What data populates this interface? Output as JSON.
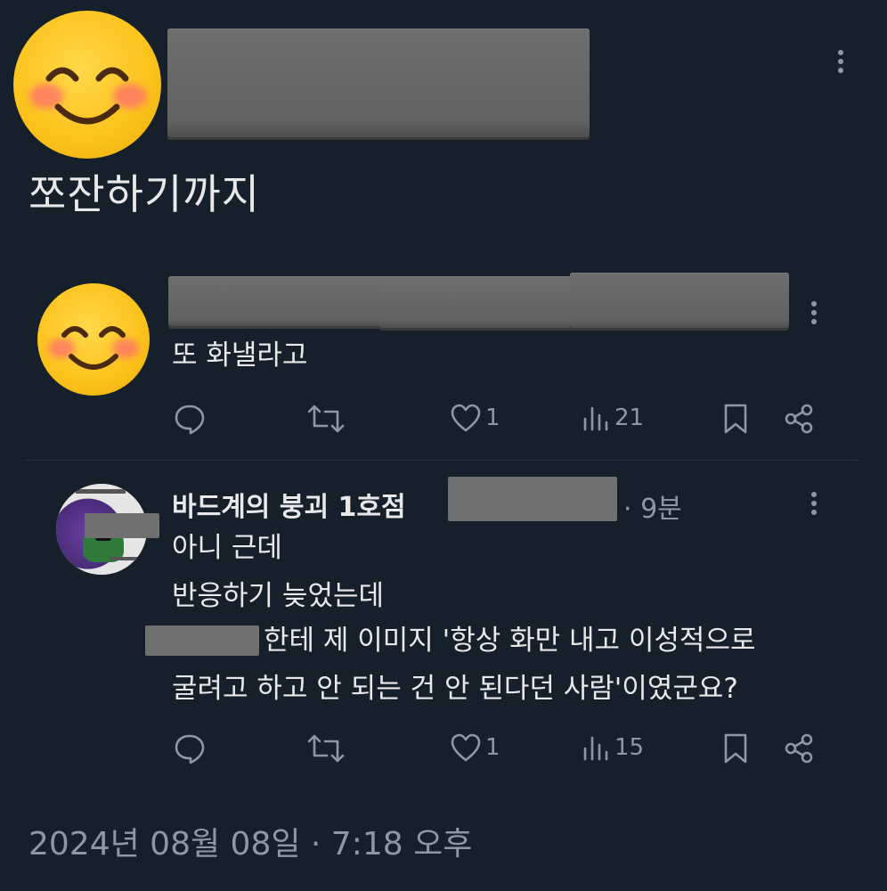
{
  "main_post": {
    "text": "쪼잔하기까지"
  },
  "reply1": {
    "text": "또 화낼라고",
    "actions": {
      "likes": "1",
      "views": "21"
    }
  },
  "reply2": {
    "name": "바드계의 붕괴 1호점",
    "time": "· 9분",
    "lines": [
      "아니 근데",
      "반응하기 늦었는데",
      "한테 제 이미지 '항상 화만 내고 이성적으로",
      "굴려고 하고 안 되는 건 안 된다던 사람'이였군요?"
    ],
    "actions": {
      "likes": "1",
      "views": "15"
    }
  },
  "footer": {
    "timestamp": "2024년 08월 08일 · 7:18 오후"
  },
  "colors": {
    "background": "#15202b",
    "text": "#e7e9ea",
    "muted": "#8b98a5"
  }
}
